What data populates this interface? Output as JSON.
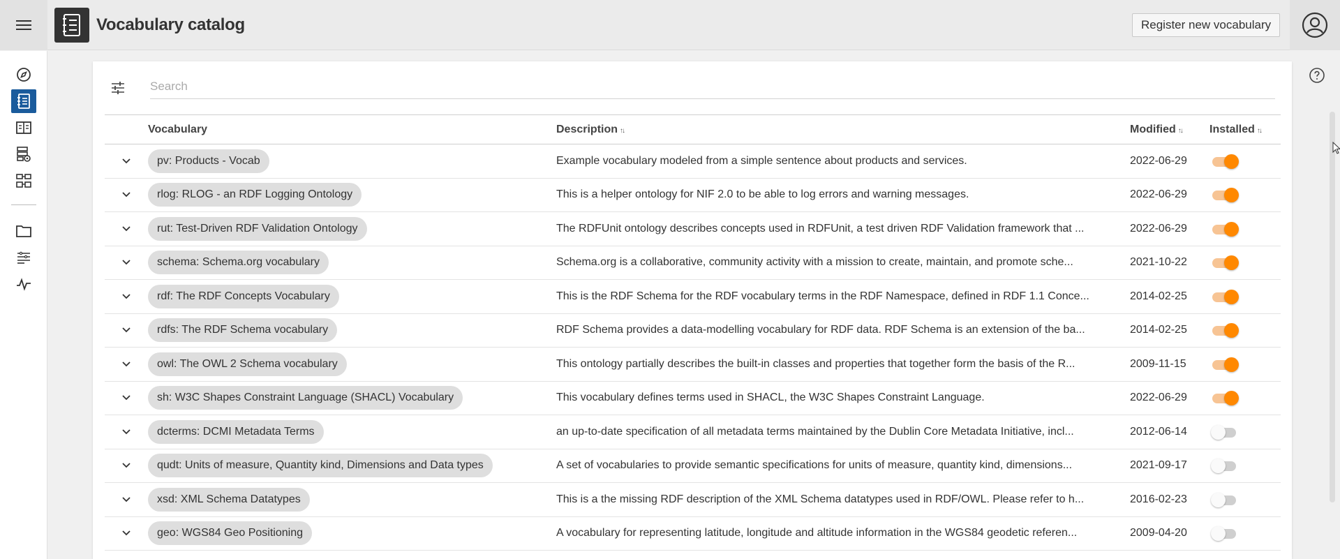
{
  "header": {
    "title": "Vocabulary catalog",
    "register_button": "Register new vocabulary",
    "menu_icon": "hamburger-menu-icon",
    "app_icon": "catalog-book-icon",
    "user_icon": "user-account-icon"
  },
  "sidebar": {
    "items": [
      {
        "icon": "compass-icon",
        "active": false
      },
      {
        "icon": "catalog-list-icon",
        "active": true
      },
      {
        "icon": "book-open-icon",
        "active": false
      },
      {
        "icon": "dataset-view-icon",
        "active": false
      },
      {
        "icon": "graph-stack-icon",
        "active": false
      },
      {
        "icon": "folder-icon",
        "active": false
      },
      {
        "icon": "list-filter-icon",
        "active": false
      },
      {
        "icon": "activity-icon",
        "active": false
      }
    ]
  },
  "search": {
    "placeholder": "Search",
    "value": ""
  },
  "table": {
    "columns": {
      "vocabulary": "Vocabulary",
      "description": "Description",
      "modified": "Modified",
      "installed": "Installed"
    },
    "sort_glyph": "↑↓",
    "rows": [
      {
        "vocabulary": "pv: Products - Vocab",
        "description": "Example vocabulary modeled from a simple sentence about products and services.",
        "modified": "2022-06-29",
        "installed": true
      },
      {
        "vocabulary": "rlog: RLOG - an RDF Logging Ontology",
        "description": "This is a helper ontology for NIF 2.0 to be able to log errors and warning messages.",
        "modified": "2022-06-29",
        "installed": true
      },
      {
        "vocabulary": "rut: Test-Driven RDF Validation Ontology",
        "description": "The RDFUnit ontology describes concepts used in RDFUnit, a test driven RDF Validation framework that ...",
        "modified": "2022-06-29",
        "installed": true
      },
      {
        "vocabulary": "schema: Schema.org vocabulary",
        "description": "Schema.org is a collaborative, community activity with a mission to create, maintain, and promote sche...",
        "modified": "2021-10-22",
        "installed": true
      },
      {
        "vocabulary": "rdf: The RDF Concepts Vocabulary",
        "description": "This is the RDF Schema for the RDF vocabulary terms in the RDF Namespace, defined in RDF 1.1 Conce...",
        "modified": "2014-02-25",
        "installed": true
      },
      {
        "vocabulary": "rdfs: The RDF Schema vocabulary",
        "description": "RDF Schema provides a data-modelling vocabulary for RDF data. RDF Schema is an extension of the ba...",
        "modified": "2014-02-25",
        "installed": true
      },
      {
        "vocabulary": "owl: The OWL 2 Schema vocabulary",
        "description": "This ontology partially describes the built-in classes and properties that together form the basis of the R...",
        "modified": "2009-11-15",
        "installed": true
      },
      {
        "vocabulary": "sh: W3C Shapes Constraint Language (SHACL) Vocabulary",
        "description": "This vocabulary defines terms used in SHACL, the W3C Shapes Constraint Language.",
        "modified": "2022-06-29",
        "installed": true
      },
      {
        "vocabulary": "dcterms: DCMI Metadata Terms",
        "description": "an up-to-date specification of all metadata terms maintained by the Dublin Core Metadata Initiative, incl...",
        "modified": "2012-06-14",
        "installed": false
      },
      {
        "vocabulary": "qudt: Units of measure, Quantity kind, Dimensions and Data types",
        "description": "A set of vocabularies to provide semantic specifications for units of measure, quantity kind, dimensions...",
        "modified": "2021-09-17",
        "installed": false
      },
      {
        "vocabulary": "xsd: XML Schema Datatypes",
        "description": "This is a the missing RDF description of the XML Schema datatypes used in RDF/OWL. Please refer to h...",
        "modified": "2016-02-23",
        "installed": false
      },
      {
        "vocabulary": "geo: WGS84 Geo Positioning",
        "description": "A vocabulary for representing latitude, longitude and altitude information in the WGS84 geodetic referen...",
        "modified": "2009-04-20",
        "installed": false
      }
    ]
  },
  "colors": {
    "accent": "#1a5b9c",
    "toggle_on": "#ff8800",
    "toggle_on_track": "#f7c494"
  }
}
